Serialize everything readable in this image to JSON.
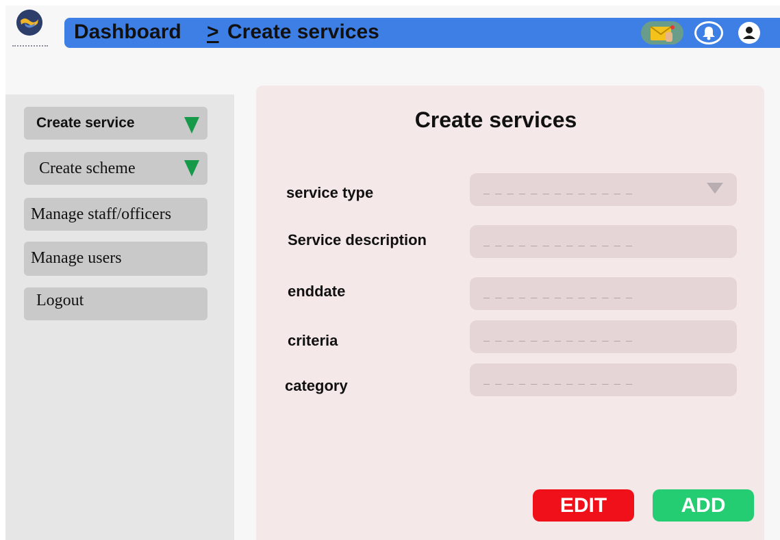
{
  "header": {
    "breadcrumb": {
      "root": "Dashboard",
      "separator": ">",
      "current": "Create services"
    },
    "icons": [
      "mail-icon",
      "bell-icon",
      "user-icon"
    ],
    "bar_color": "#3e7fe6"
  },
  "sidebar": {
    "items": [
      {
        "label": "Create service",
        "has_dropdown": true
      },
      {
        "label": "Create scheme",
        "has_dropdown": true
      },
      {
        "label": "Manage staff/officers",
        "has_dropdown": false
      },
      {
        "label": "Manage users",
        "has_dropdown": false
      },
      {
        "label": "Logout",
        "has_dropdown": false
      }
    ]
  },
  "form": {
    "title": "Create services",
    "fields": [
      {
        "label": "service type",
        "placeholder": "_ _ _ _ _ _ _ _ _ _ _ _ _",
        "value": "",
        "type": "select"
      },
      {
        "label": "Service description",
        "placeholder": "_ _ _ _ _ _ _ _ _ _ _ _ _",
        "value": "",
        "type": "text"
      },
      {
        "label": "enddate",
        "placeholder": "_ _ _ _ _ _ _ _ _ _ _ _ _",
        "value": "",
        "type": "text"
      },
      {
        "label": "criteria",
        "placeholder": "_ _ _ _ _ _ _ _ _ _ _ _ _",
        "value": "",
        "type": "text"
      },
      {
        "label": "category",
        "placeholder": "_ _ _ _ _ _ _ _ _ _ _ _ _",
        "value": "",
        "type": "text"
      }
    ],
    "buttons": {
      "edit_label": "EDIT",
      "add_label": "ADD"
    }
  },
  "colors": {
    "edit": "#f0101a",
    "add": "#24cc72",
    "dropdown_indicator": "#17994a"
  }
}
